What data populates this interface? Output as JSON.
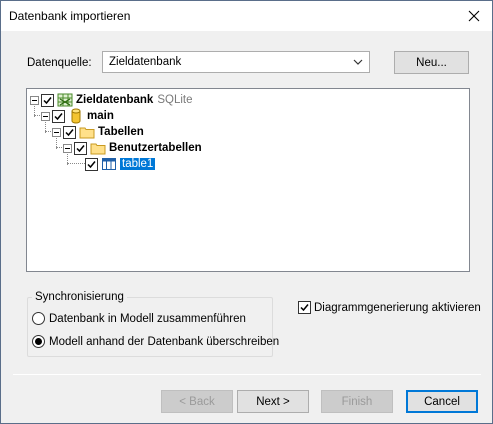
{
  "window": {
    "title": "Datenbank importieren"
  },
  "datasource": {
    "label": "Datenquelle:",
    "selected": "Zieldatenbank",
    "new_button": "Neu..."
  },
  "tree": {
    "root": {
      "name": "Zieldatenbank",
      "type": "SQLite"
    },
    "schema": "main",
    "tables_folder": "Tabellen",
    "user_tables": "Benutzertabellen",
    "table": "table1"
  },
  "sync": {
    "legend": "Synchronisierung",
    "option_merge": "Datenbank in Modell zusammenführen",
    "option_overwrite": "Modell anhand der Datenbank überschreiben",
    "selected": "option_overwrite"
  },
  "diagram": {
    "label": "Diagrammgenerierung aktivieren",
    "checked": true
  },
  "buttons": {
    "back": "< Back",
    "next": "Next >",
    "finish": "Finish",
    "cancel": "Cancel"
  }
}
